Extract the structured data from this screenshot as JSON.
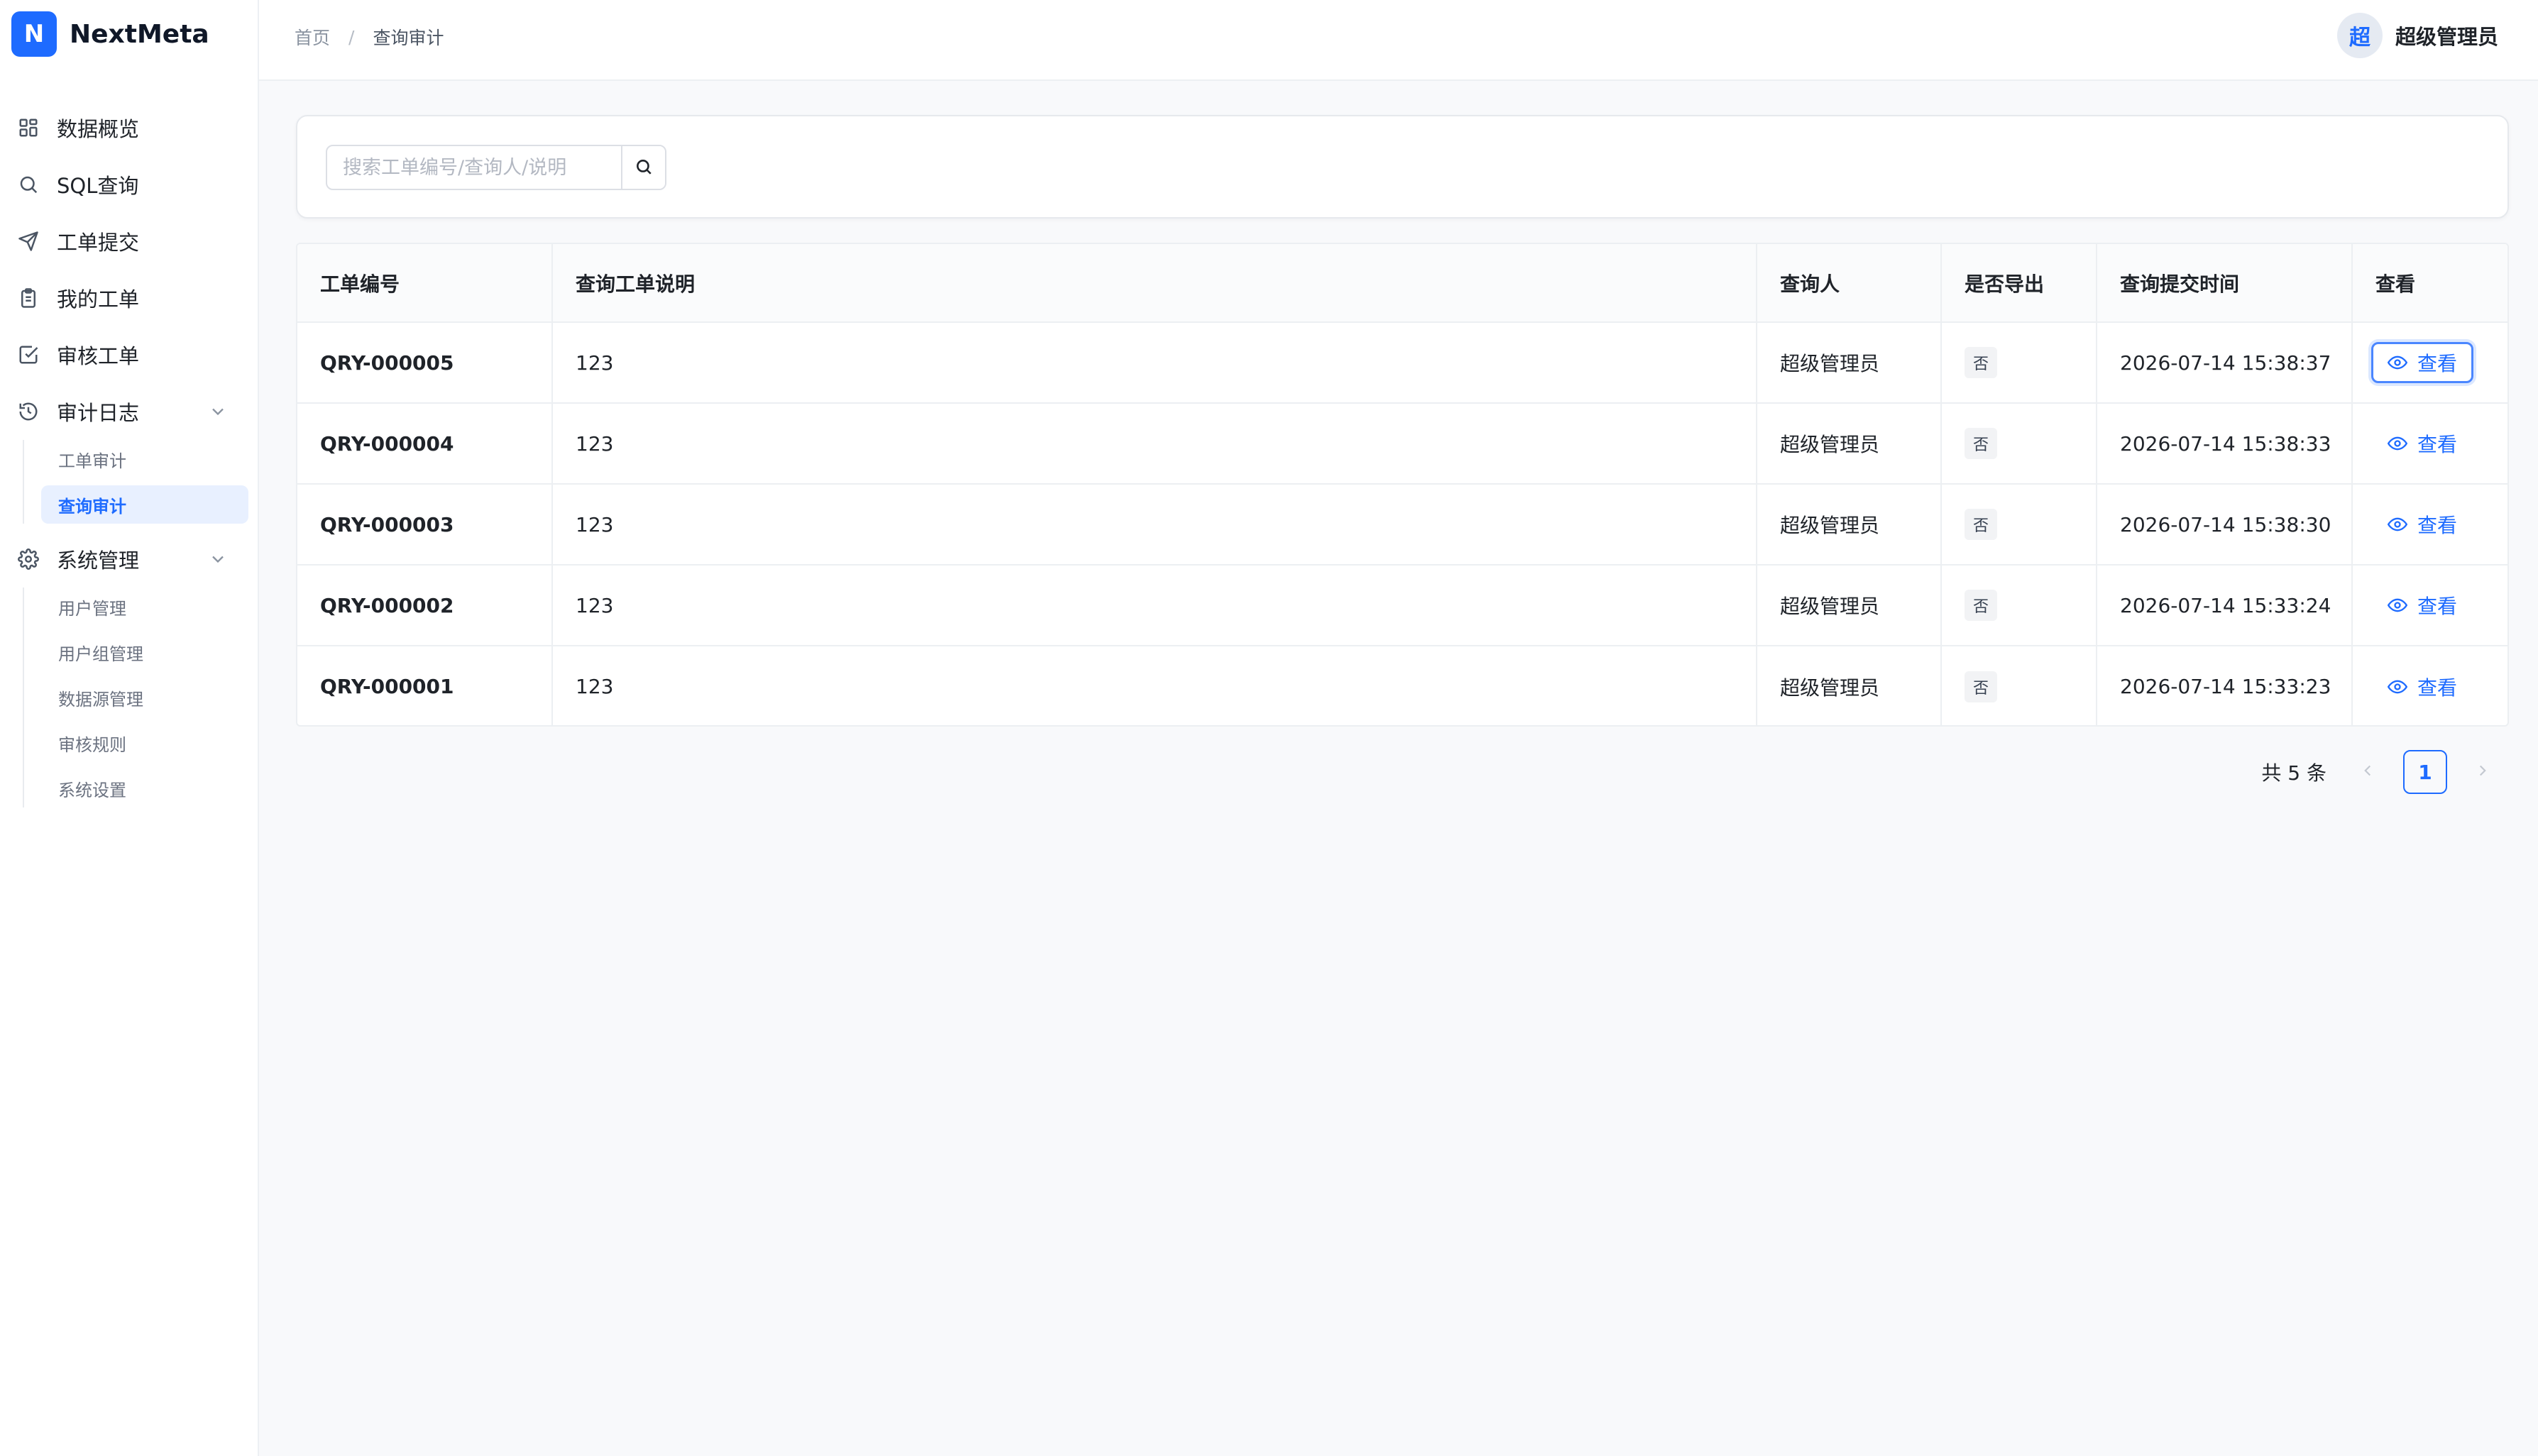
{
  "brand": {
    "logo_letter": "N",
    "name": "NextMeta",
    "accent": "#1e6bff"
  },
  "nav": {
    "items": [
      {
        "label": "数据概览",
        "icon": "dashboard-icon"
      },
      {
        "label": "SQL查询",
        "icon": "search-icon"
      },
      {
        "label": "工单提交",
        "icon": "send-icon"
      },
      {
        "label": "我的工单",
        "icon": "clipboard-icon"
      },
      {
        "label": "审核工单",
        "icon": "check-square-icon"
      },
      {
        "label": "审计日志",
        "icon": "history-icon",
        "expanded": true
      },
      {
        "label": "系统管理",
        "icon": "gear-icon",
        "expanded": true
      }
    ],
    "audit_sub": [
      "工单审计",
      "查询审计"
    ],
    "audit_active": "查询审计",
    "system_sub": [
      "用户管理",
      "用户组管理",
      "数据源管理",
      "审核规则",
      "系统设置"
    ]
  },
  "header": {
    "breadcrumb": [
      "首页",
      "查询审计"
    ],
    "separator": "/",
    "user": {
      "avatar_text": "超",
      "name": "超级管理员"
    }
  },
  "search": {
    "placeholder": "搜索工单编号/查询人/说明",
    "value": ""
  },
  "table": {
    "columns": [
      "工单编号",
      "查询工单说明",
      "查询人",
      "是否导出",
      "查询提交时间",
      "查看"
    ],
    "rows": [
      {
        "id": "QRY-000005",
        "desc": "123",
        "user": "超级管理员",
        "exported": "否",
        "time": "2026-07-14 15:38:37",
        "action": "查看"
      },
      {
        "id": "QRY-000004",
        "desc": "123",
        "user": "超级管理员",
        "exported": "否",
        "time": "2026-07-14 15:38:33",
        "action": "查看"
      },
      {
        "id": "QRY-000003",
        "desc": "123",
        "user": "超级管理员",
        "exported": "否",
        "time": "2026-07-14 15:38:30",
        "action": "查看"
      },
      {
        "id": "QRY-000002",
        "desc": "123",
        "user": "超级管理员",
        "exported": "否",
        "time": "2026-07-14 15:33:24",
        "action": "查看"
      },
      {
        "id": "QRY-000001",
        "desc": "123",
        "user": "超级管理员",
        "exported": "否",
        "time": "2026-07-14 15:33:23",
        "action": "查看"
      }
    ]
  },
  "pagination": {
    "total_text": "共 5 条",
    "current_page": "1"
  }
}
